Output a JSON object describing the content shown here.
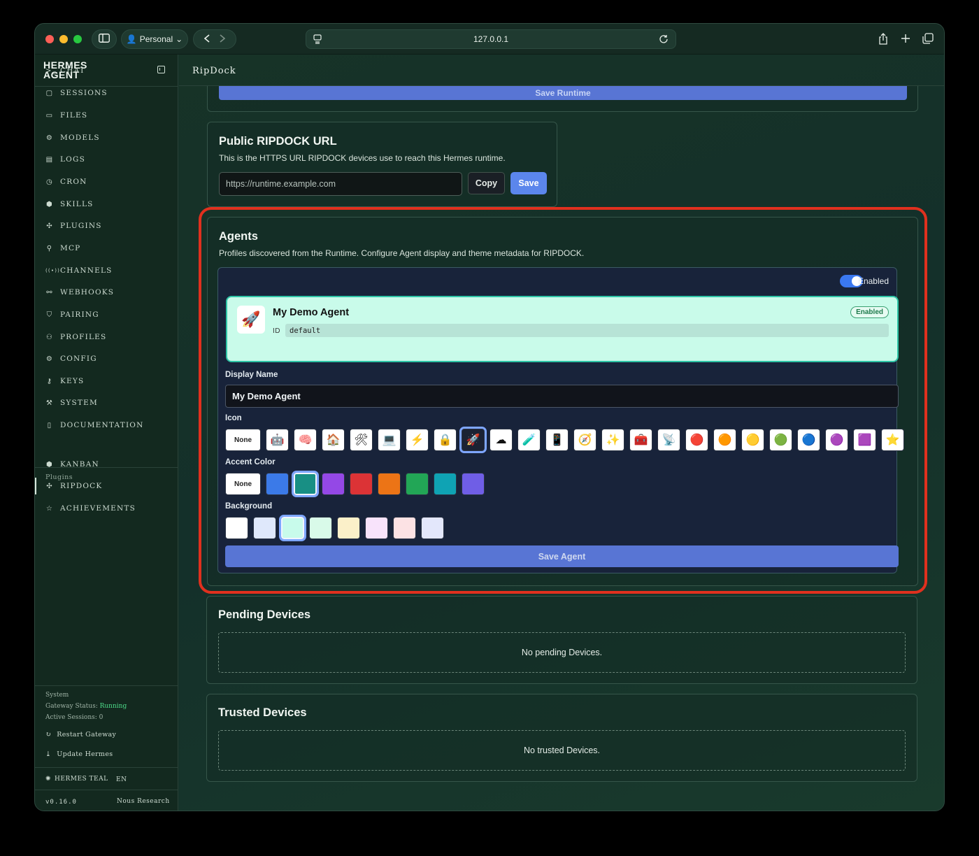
{
  "browser": {
    "profile_label": "Personal",
    "url": "127.0.0.1"
  },
  "sidebar": {
    "brand": "HERMES AGENT",
    "items": [
      {
        "label": "CHAT",
        "icon": ">_"
      },
      {
        "label": "SESSIONS",
        "icon": "▢"
      },
      {
        "label": "FILES",
        "icon": "▭"
      },
      {
        "label": "MODELS",
        "icon": "⚙"
      },
      {
        "label": "LOGS",
        "icon": "▤"
      },
      {
        "label": "CRON",
        "icon": "◷"
      },
      {
        "label": "SKILLS",
        "icon": "⬢"
      },
      {
        "label": "PLUGINS",
        "icon": "✣"
      },
      {
        "label": "MCP",
        "icon": "⚲"
      },
      {
        "label": "CHANNELS",
        "icon": "((•))"
      },
      {
        "label": "WEBHOOKS",
        "icon": "⚯"
      },
      {
        "label": "PAIRING",
        "icon": "⛉"
      },
      {
        "label": "PROFILES",
        "icon": "⚇"
      },
      {
        "label": "CONFIG",
        "icon": "⚙"
      },
      {
        "label": "KEYS",
        "icon": "⚷"
      },
      {
        "label": "SYSTEM",
        "icon": "⚒"
      },
      {
        "label": "DOCUMENTATION",
        "icon": "▯"
      }
    ],
    "plugins_label": "Plugins",
    "plugin_items": [
      {
        "label": "KANBAN",
        "icon": "⬢"
      },
      {
        "label": "RIPDOCK",
        "icon": "✣"
      },
      {
        "label": "ACHIEVEMENTS",
        "icon": "☆"
      }
    ],
    "system": {
      "heading": "System",
      "gateway_label": "Gateway Status:",
      "gateway_value": "Running",
      "sessions_text": "Active Sessions: 0"
    },
    "restart_label": "Restart Gateway",
    "update_label": "Update Hermes",
    "theme_label": "HERMES TEAL",
    "lang_label": "EN",
    "version": "v0.16.0",
    "vendor": "Nous Research"
  },
  "page": {
    "title": "RipDock",
    "save_runtime_label": "Save Runtime"
  },
  "public_url": {
    "title": "Public RIPDOCK URL",
    "description": "This is the HTTPS URL RIPDOCK devices use to reach this Hermes runtime.",
    "placeholder": "https://runtime.example.com",
    "copy_label": "Copy",
    "save_label": "Save"
  },
  "agents": {
    "title": "Agents",
    "description": "Profiles discovered from the Runtime. Configure Agent display and theme metadata for RIPDOCK.",
    "toggle_label": "Enabled",
    "agent": {
      "icon": "🚀",
      "name": "My Demo Agent",
      "badge": "Enabled",
      "id_label": "ID",
      "id_value": "default"
    },
    "display_name_label": "Display Name",
    "display_name_value": "My Demo Agent",
    "icon_label": "Icon",
    "none_label": "None",
    "icons": [
      "🤖",
      "🧠",
      "🏠",
      "🛠",
      "💻",
      "⚡",
      "🔒",
      "🚀",
      "☁",
      "🧪",
      "📱",
      "🧭",
      "✨",
      "🧰",
      "📡",
      "🔴",
      "🟠",
      "🟡",
      "🟢",
      "🔵",
      "🟣",
      "🟪",
      "⭐"
    ],
    "selected_icon": "🚀",
    "accent_label": "Accent Color",
    "accent_colors": [
      "#3b7ae8",
      "#188f84",
      "#9448e6",
      "#dc3336",
      "#ec7416",
      "#22a656",
      "#0fa3b4",
      "#6f5ee6"
    ],
    "selected_accent": "#188f84",
    "background_label": "Background",
    "background_colors": [
      "#ffffff",
      "#dfe8fb",
      "#c8fbeb",
      "#d9fae9",
      "#fbf0c9",
      "#f8e3fb",
      "#fce2e4",
      "#e3e7fb"
    ],
    "selected_background": "#c8fbeb",
    "save_label": "Save Agent"
  },
  "pending": {
    "title": "Pending Devices",
    "empty": "No pending Devices."
  },
  "trusted": {
    "title": "Trusted Devices",
    "empty": "No trusted Devices."
  }
}
